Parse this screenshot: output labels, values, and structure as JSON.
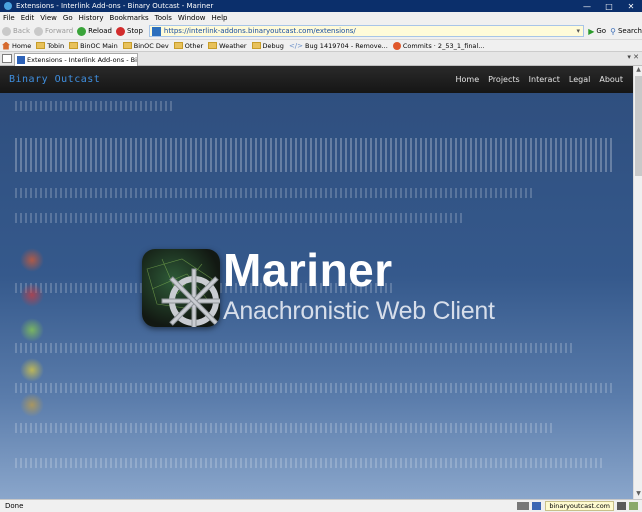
{
  "window": {
    "title": "Extensions - Interlink Add-ons - Binary Outcast - Mariner"
  },
  "menu": [
    "File",
    "Edit",
    "View",
    "Go",
    "History",
    "Bookmarks",
    "Tools",
    "Window",
    "Help"
  ],
  "toolbar": {
    "back": "Back",
    "forward": "Forward",
    "reload": "Reload",
    "stop": "Stop",
    "url": "https://interlink-addons.binaryoutcast.com/extensions/",
    "go": "Go",
    "search": "Search"
  },
  "bookmarks": [
    "Home",
    "Tobin",
    "BinOC Main",
    "BinOC Dev",
    "Other",
    "Weather",
    "Debug",
    "Bug 1419704 - Remove...",
    "Commits · 2_53_1_final..."
  ],
  "tab": {
    "label": "Extensions - Interlink Add-ons - Binar..."
  },
  "site": {
    "brand": "Binary Outcast",
    "nav": [
      "Home",
      "Projects",
      "Interact",
      "Legal",
      "About"
    ],
    "hero_title": "Mariner",
    "hero_subtitle": "Anachronistic Web Client"
  },
  "status": {
    "text": "Done",
    "domain": "binaryoutcast.com"
  },
  "colors": {
    "titlebar": "#0b2f6b",
    "brand": "#3f8fe0",
    "hero_bg": "#2f5286"
  }
}
